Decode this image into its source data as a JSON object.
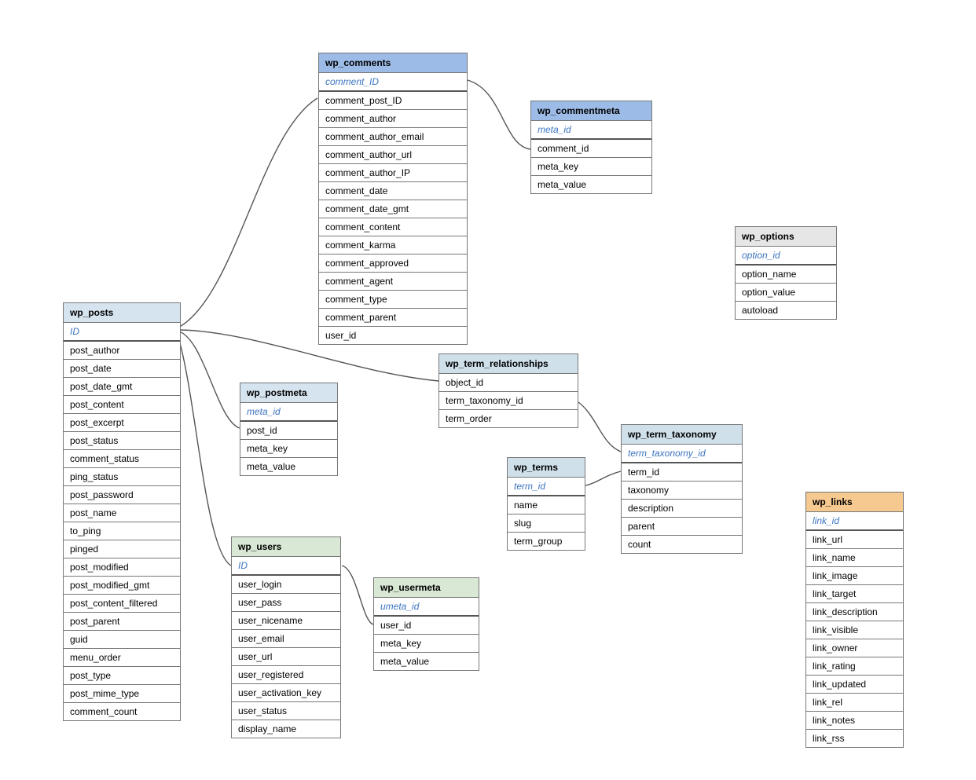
{
  "tables": {
    "wp_posts": {
      "title": "wp_posts",
      "pk": "ID",
      "fields": [
        "post_author",
        "post_date",
        "post_date_gmt",
        "post_content",
        "post_excerpt",
        "post_status",
        "comment_status",
        "ping_status",
        "post_password",
        "post_name",
        "to_ping",
        "pinged",
        "post_modified",
        "post_modified_gmt",
        "post_content_filtered",
        "post_parent",
        "guid",
        "menu_order",
        "post_type",
        "post_mime_type",
        "comment_count"
      ]
    },
    "wp_postmeta": {
      "title": "wp_postmeta",
      "pk": "meta_id",
      "fields": [
        "post_id",
        "meta_key",
        "meta_value"
      ]
    },
    "wp_comments": {
      "title": "wp_comments",
      "pk": "comment_ID",
      "fields": [
        "comment_post_ID",
        "comment_author",
        "comment_author_email",
        "comment_author_url",
        "comment_author_IP",
        "comment_date",
        "comment_date_gmt",
        "comment_content",
        "comment_karma",
        "comment_approved",
        "comment_agent",
        "comment_type",
        "comment_parent",
        "user_id"
      ]
    },
    "wp_commentmeta": {
      "title": "wp_commentmeta",
      "pk": "meta_id",
      "fields": [
        "comment_id",
        "meta_key",
        "meta_value"
      ]
    },
    "wp_term_relationships": {
      "title": "wp_term_relationships",
      "fields": [
        "object_id",
        "term_taxonomy_id",
        "term_order"
      ]
    },
    "wp_term_taxonomy": {
      "title": "wp_term_taxonomy",
      "pk": "term_taxonomy_id",
      "fields": [
        "term_id",
        "taxonomy",
        "description",
        "parent",
        "count"
      ]
    },
    "wp_terms": {
      "title": "wp_terms",
      "pk": "term_id",
      "fields": [
        "name",
        "slug",
        "term_group"
      ]
    },
    "wp_users": {
      "title": "wp_users",
      "pk": "ID",
      "fields": [
        "user_login",
        "user_pass",
        "user_nicename",
        "user_email",
        "user_url",
        "user_registered",
        "user_activation_key",
        "user_status",
        "display_name"
      ]
    },
    "wp_usermeta": {
      "title": "wp_usermeta",
      "pk": "umeta_id",
      "fields": [
        "user_id",
        "meta_key",
        "meta_value"
      ]
    },
    "wp_options": {
      "title": "wp_options",
      "pk": "option_id",
      "fields": [
        "option_name",
        "option_value",
        "autoload"
      ]
    },
    "wp_links": {
      "title": "wp_links",
      "pk": "link_id",
      "fields": [
        "link_url",
        "link_name",
        "link_image",
        "link_target",
        "link_description",
        "link_visible",
        "link_owner",
        "link_rating",
        "link_updated",
        "link_rel",
        "link_notes",
        "link_rss"
      ]
    }
  }
}
